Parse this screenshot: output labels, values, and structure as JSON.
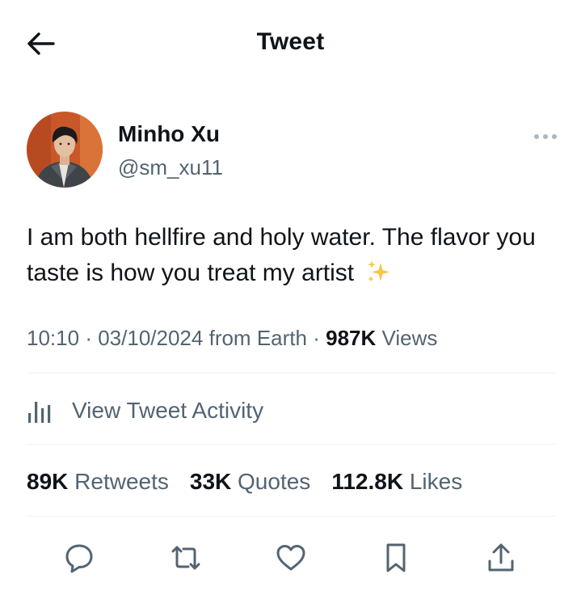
{
  "header": {
    "title": "Tweet",
    "back_icon": "arrow-left-icon"
  },
  "author": {
    "name": "Minho Xu",
    "handle": "@sm_xu11",
    "avatar_bg": "#c8582a"
  },
  "tweet": {
    "text": "I am both hellfire and holy water. The flavor you taste is how you treat my artist",
    "emoji_icon": "sparkles-icon"
  },
  "meta": {
    "time": "10:10",
    "date": "03/10/2024",
    "source": "from Earth",
    "separator": "·",
    "views_count": "987K",
    "views_label": "Views"
  },
  "activity": {
    "label": "View Tweet Activity",
    "icon": "bar-chart-icon"
  },
  "stats": [
    {
      "count": "89K",
      "label": "Retweets"
    },
    {
      "count": "33K",
      "label": "Quotes"
    },
    {
      "count": "112.8K",
      "label": "Likes"
    }
  ],
  "actions": [
    "reply-icon",
    "retweet-icon",
    "like-icon",
    "bookmark-icon",
    "share-icon"
  ],
  "colors": {
    "text": "#0f1419",
    "secondary": "#536471",
    "divider": "#eff3f4",
    "sparkle": "#f5c84a"
  }
}
